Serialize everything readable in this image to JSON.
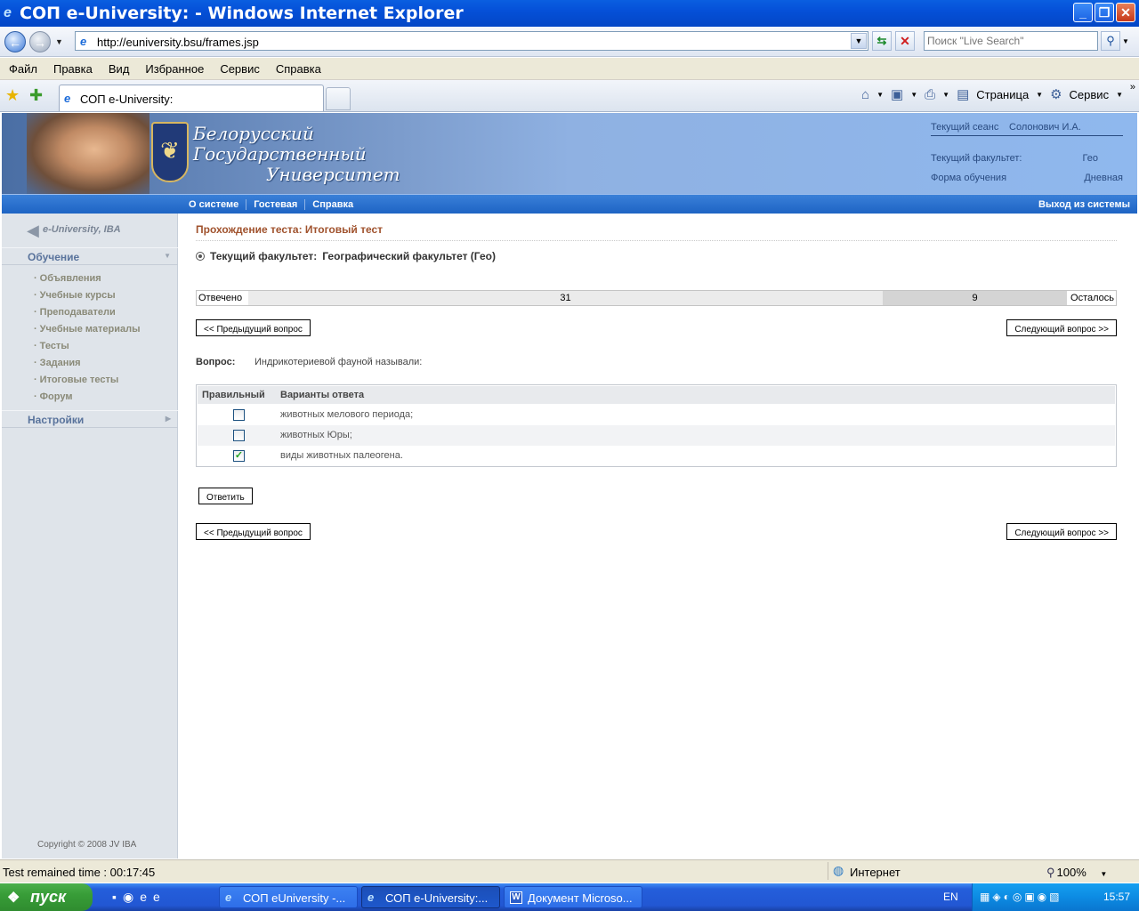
{
  "window": {
    "title": "СОП e-University:  - Windows Internet Explorer",
    "minimize": "_",
    "maximize": "❐",
    "close": "✕"
  },
  "address": {
    "url": "http://euniversity.bsu/frames.jsp",
    "search_placeholder": "Поиск \"Live Search\""
  },
  "menu": [
    "Файл",
    "Правка",
    "Вид",
    "Избранное",
    "Сервис",
    "Справка"
  ],
  "tab": {
    "label": "СОП e-University:"
  },
  "commandbar": {
    "page_label": "Страница",
    "tools_label": "Сервис"
  },
  "banner": {
    "line1": "Белорусский",
    "line2": "Государственный",
    "line3": "Университет",
    "session_label": "Текущий сеанс",
    "session_user": "Солонович И.А.",
    "faculty_label": "Текущий факультет:",
    "faculty_value": "Гео",
    "form_label": "Форма обучения",
    "form_value": "Дневная"
  },
  "nav": {
    "links": [
      "О системе",
      "Гостевая",
      "Справка"
    ],
    "logout": "Выход из системы"
  },
  "sidebar": {
    "logo": "e-University, IBA",
    "section_learning": "Обучение",
    "items": [
      "Объявления",
      "Учебные курсы",
      "Преподаватели",
      "Учебные материалы",
      "Тесты",
      "Задания",
      "Итоговые тесты",
      "Форум"
    ],
    "section_settings": "Настройки",
    "copyright": "Copyright © 2008 JV IBA"
  },
  "main": {
    "title": "Прохождение теста: Итоговый тест",
    "faculty_label": "Текущий факультет:",
    "faculty_value": "Географический факультет (Гео)",
    "progress": {
      "answered_label": "Отвечено",
      "remaining_label": "Осталось",
      "answered": 31,
      "remaining": 9
    },
    "prev_button": "<< Предыдущий вопрос",
    "next_button": "Следующий вопрос >>",
    "question_label": "Вопрос:",
    "question_text": "Индрикотериевой фауной называли:",
    "answers_header": {
      "correct": "Правильный",
      "options": "Варианты ответа"
    },
    "answers": [
      {
        "text": "животных мелового периода;",
        "checked": false
      },
      {
        "text": "животных Юры;",
        "checked": false
      },
      {
        "text": "виды животных палеогена.",
        "checked": true
      }
    ],
    "submit_button": "Ответить"
  },
  "status": {
    "text": "Test remained time :  00:17:45",
    "zone": "Интернет",
    "zoom": "100%"
  },
  "taskbar": {
    "start": "пуск",
    "tasks": [
      "СОП eUniversity -...",
      "СОП e-University:...",
      "Документ Microso..."
    ],
    "lang": "EN",
    "clock": "15:57"
  }
}
